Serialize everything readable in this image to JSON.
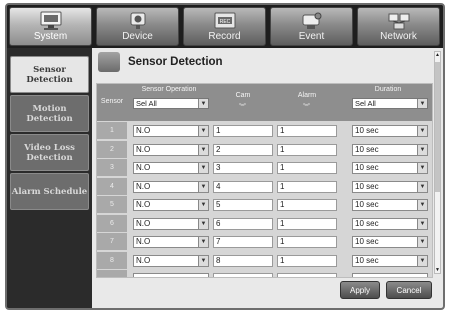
{
  "topnav": {
    "tabs": [
      {
        "label": "System",
        "icon": "monitor-icon",
        "active": true
      },
      {
        "label": "Device",
        "icon": "camera-icon",
        "active": false
      },
      {
        "label": "Record",
        "icon": "rec-icon",
        "active": false
      },
      {
        "label": "Event",
        "icon": "event-camera-icon",
        "active": false
      },
      {
        "label": "Network",
        "icon": "network-icon",
        "active": false
      }
    ]
  },
  "sidebar": {
    "items": [
      {
        "label": "Sensor Detection",
        "active": true
      },
      {
        "label": "Motion Detection",
        "active": false
      },
      {
        "label": "Video Loss Detection",
        "active": false
      },
      {
        "label": "Alarm Schedule",
        "active": false
      }
    ]
  },
  "main": {
    "title": "Sensor Detection",
    "headers": {
      "sensor": "Sensor",
      "sensor_operation": "Sensor Operation",
      "cam": "Cam",
      "alarm": "Alarm",
      "duration": "Duration",
      "sensor_operation_all": "Sel All",
      "duration_all": "Sel All"
    },
    "rows": [
      {
        "sensor": "1",
        "operation": "N.O",
        "cam": "1",
        "alarm": "1",
        "duration": "10 sec"
      },
      {
        "sensor": "2",
        "operation": "N.O",
        "cam": "2",
        "alarm": "1",
        "duration": "10 sec"
      },
      {
        "sensor": "3",
        "operation": "N.O",
        "cam": "3",
        "alarm": "1",
        "duration": "10 sec"
      },
      {
        "sensor": "4",
        "operation": "N.O",
        "cam": "4",
        "alarm": "1",
        "duration": "10 sec"
      },
      {
        "sensor": "5",
        "operation": "N.O",
        "cam": "5",
        "alarm": "1",
        "duration": "10 sec"
      },
      {
        "sensor": "6",
        "operation": "N.O",
        "cam": "6",
        "alarm": "1",
        "duration": "10 sec"
      },
      {
        "sensor": "7",
        "operation": "N.O",
        "cam": "7",
        "alarm": "1",
        "duration": "10 sec"
      },
      {
        "sensor": "8",
        "operation": "N.O",
        "cam": "8",
        "alarm": "1",
        "duration": "10 sec"
      }
    ],
    "apply_label": "Apply",
    "cancel_label": "Cancel"
  }
}
